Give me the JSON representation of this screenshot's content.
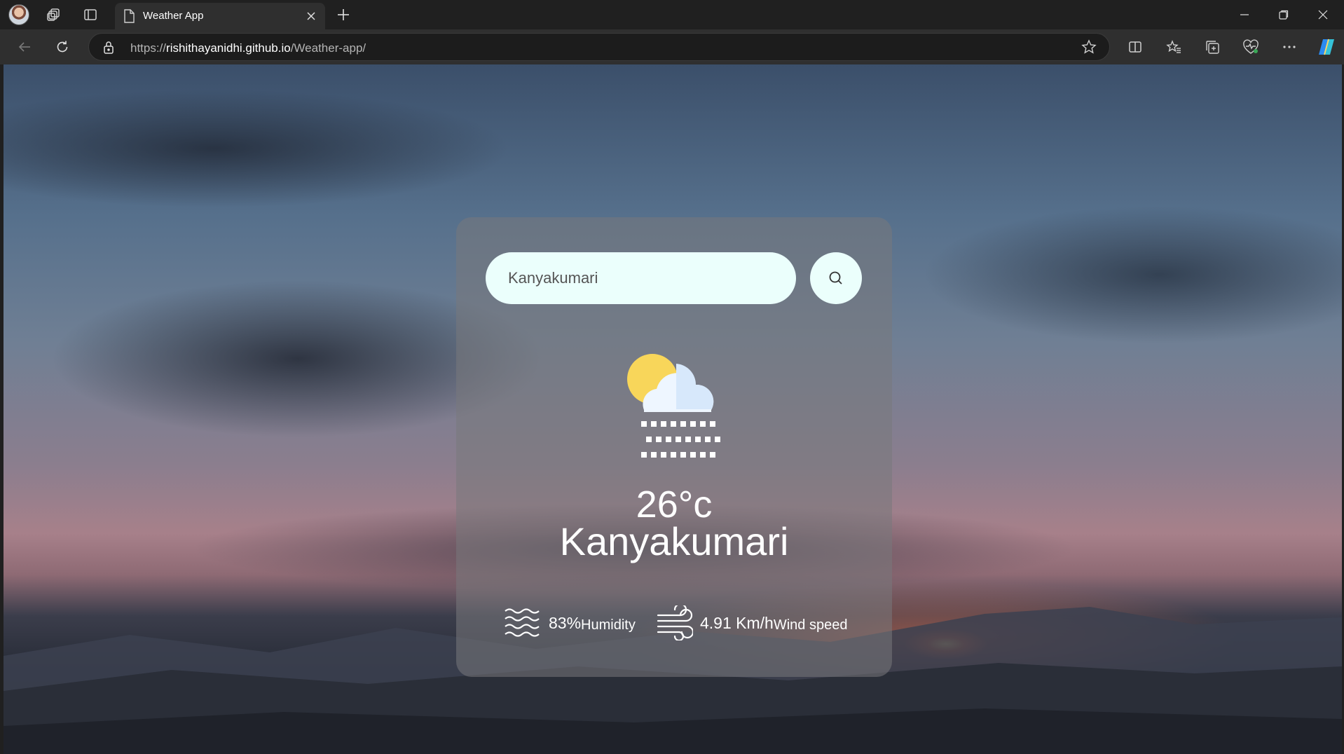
{
  "browser": {
    "tab_title": "Weather App",
    "url_scheme": "https://",
    "url_host": "rishithayanidhi.github.io",
    "url_path": "/Weather-app/"
  },
  "weather": {
    "search_value": "Kanyakumari",
    "condition_icon": "partly-cloudy-snow-icon",
    "temperature": "26°c",
    "city": "Kanyakumari",
    "humidity_value": "83%",
    "humidity_label": "Humidity",
    "wind_value": "4.91 Km/h",
    "wind_label": "Wind speed"
  },
  "colors": {
    "input_bg": "#ebfffc",
    "card_bg": "rgba(120,120,124,0.55)",
    "text": "#ffffff"
  }
}
